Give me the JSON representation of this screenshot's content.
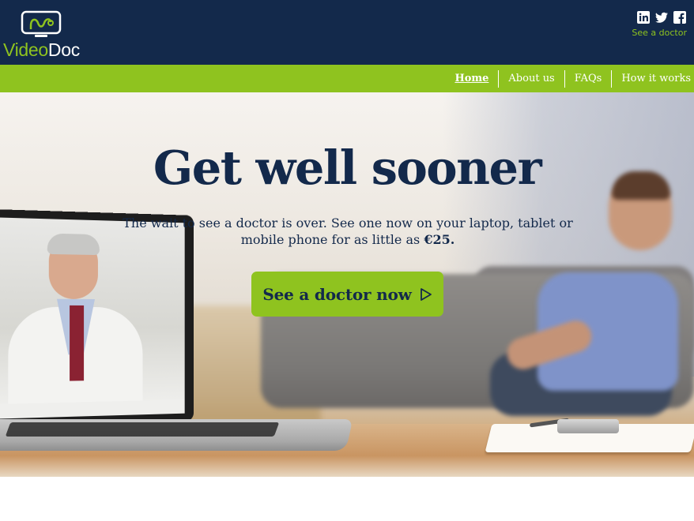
{
  "brand": {
    "name_part1": "Video",
    "name_part2": "Doc",
    "colors": {
      "navy": "#13294b",
      "green": "#8fc31f"
    }
  },
  "header": {
    "social": [
      "linkedin-icon",
      "twitter-icon",
      "facebook-icon"
    ],
    "see_doctor_link": "See a doctor"
  },
  "nav": {
    "items": [
      {
        "label": "Home",
        "active": true
      },
      {
        "label": "About us",
        "active": false
      },
      {
        "label": "FAQs",
        "active": false
      },
      {
        "label": "How it works",
        "active": false
      }
    ]
  },
  "hero": {
    "title": "Get well sooner",
    "lead_text": "The wait to see a doctor is over. See one now on your laptop, tablet or mobile phone for as little as",
    "price": "€25.",
    "cta_label": "See a doctor now",
    "cta_icon": "play-triangle-icon",
    "image": "laptop-video-call-doctor-photo"
  }
}
